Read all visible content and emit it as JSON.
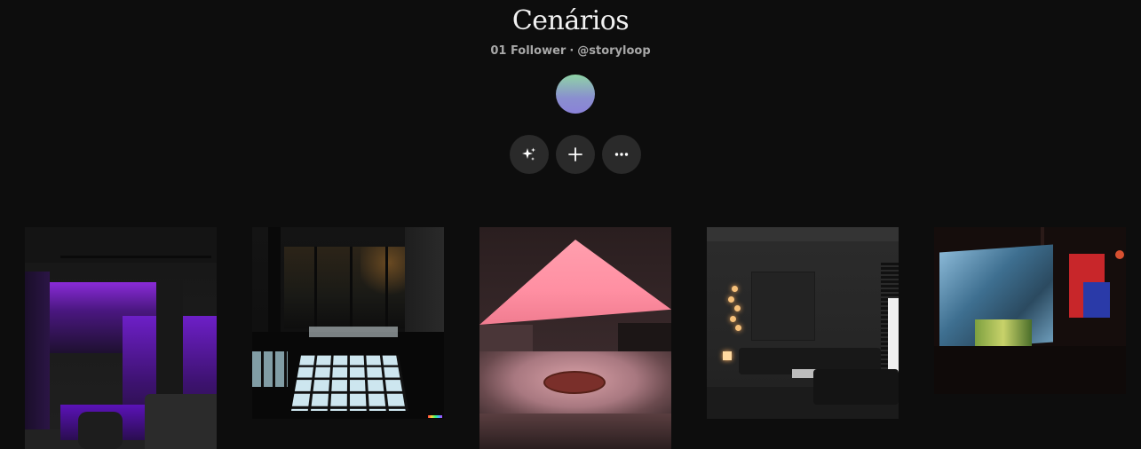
{
  "board": {
    "title": "Cenários",
    "followers": "01 Follower",
    "separator": "·",
    "handle": "@storyloop"
  },
  "actions": [
    {
      "icon": "sparkle-icon",
      "label": "AI"
    },
    {
      "icon": "plus-icon",
      "label": "Add"
    },
    {
      "icon": "more-icon",
      "label": "More"
    }
  ],
  "thumbnails": [
    {
      "name": "purple neon room"
    },
    {
      "name": "dark room with glowing floor grid"
    },
    {
      "name": "pink skylight lounge pit"
    },
    {
      "name": "grey living room"
    },
    {
      "name": "abstract blue red installation"
    }
  ],
  "colors": {
    "background": "#0d0d0d",
    "button_bg": "#2a2a2a",
    "meta_text": "#a8a8a8"
  }
}
